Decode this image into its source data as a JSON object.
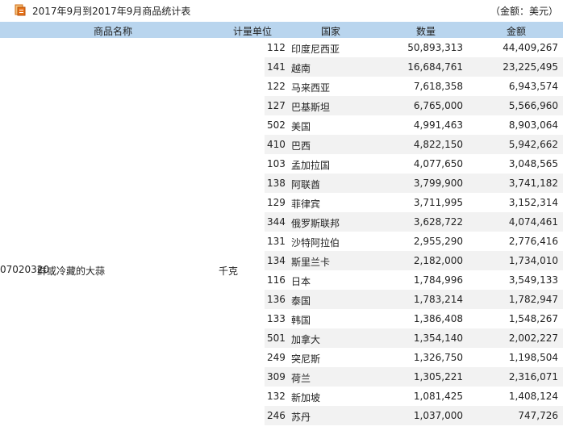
{
  "title": "2017年9月到2017年9月商品统计表",
  "unit_note": "（金额：美元）",
  "columns": {
    "name": "商品名称",
    "unit": "计量单位",
    "country": "国家",
    "quantity": "数量",
    "amount": "金额"
  },
  "product": {
    "code": "07020320",
    "name": "鲜或冷藏的大蒜",
    "unit": "千克"
  },
  "rows": [
    {
      "code": "112",
      "country": "印度尼西亚",
      "quantity": "50,893,313",
      "amount": "44,409,267"
    },
    {
      "code": "141",
      "country": "越南",
      "quantity": "16,684,761",
      "amount": "23,225,495"
    },
    {
      "code": "122",
      "country": "马来西亚",
      "quantity": "7,618,358",
      "amount": "6,943,574"
    },
    {
      "code": "127",
      "country": "巴基斯坦",
      "quantity": "6,765,000",
      "amount": "5,566,960"
    },
    {
      "code": "502",
      "country": "美国",
      "quantity": "4,991,463",
      "amount": "8,903,064"
    },
    {
      "code": "410",
      "country": "巴西",
      "quantity": "4,822,150",
      "amount": "5,942,662"
    },
    {
      "code": "103",
      "country": "孟加拉国",
      "quantity": "4,077,650",
      "amount": "3,048,565"
    },
    {
      "code": "138",
      "country": "阿联酋",
      "quantity": "3,799,900",
      "amount": "3,741,182"
    },
    {
      "code": "129",
      "country": "菲律宾",
      "quantity": "3,711,995",
      "amount": "3,152,314"
    },
    {
      "code": "344",
      "country": "俄罗斯联邦",
      "quantity": "3,628,722",
      "amount": "4,074,461"
    },
    {
      "code": "131",
      "country": "沙特阿拉伯",
      "quantity": "2,955,290",
      "amount": "2,776,416"
    },
    {
      "code": "134",
      "country": "斯里兰卡",
      "quantity": "2,182,000",
      "amount": "1,734,010"
    },
    {
      "code": "116",
      "country": "日本",
      "quantity": "1,784,996",
      "amount": "3,549,133"
    },
    {
      "code": "136",
      "country": "泰国",
      "quantity": "1,783,214",
      "amount": "1,782,947"
    },
    {
      "code": "133",
      "country": "韩国",
      "quantity": "1,386,408",
      "amount": "1,548,267"
    },
    {
      "code": "501",
      "country": "加拿大",
      "quantity": "1,354,140",
      "amount": "2,002,227"
    },
    {
      "code": "249",
      "country": "突尼斯",
      "quantity": "1,326,750",
      "amount": "1,198,504"
    },
    {
      "code": "309",
      "country": "荷兰",
      "quantity": "1,305,221",
      "amount": "2,316,071"
    },
    {
      "code": "132",
      "country": "新加坡",
      "quantity": "1,081,425",
      "amount": "1,408,124"
    },
    {
      "code": "246",
      "country": "苏丹",
      "quantity": "1,037,000",
      "amount": "747,726"
    }
  ],
  "colors": {
    "header_bg": "#b9d5ee",
    "alt_row_bg": "#f2f2f2",
    "icon_orange": "#e8731a"
  },
  "icons": {
    "title": "report-icon"
  }
}
